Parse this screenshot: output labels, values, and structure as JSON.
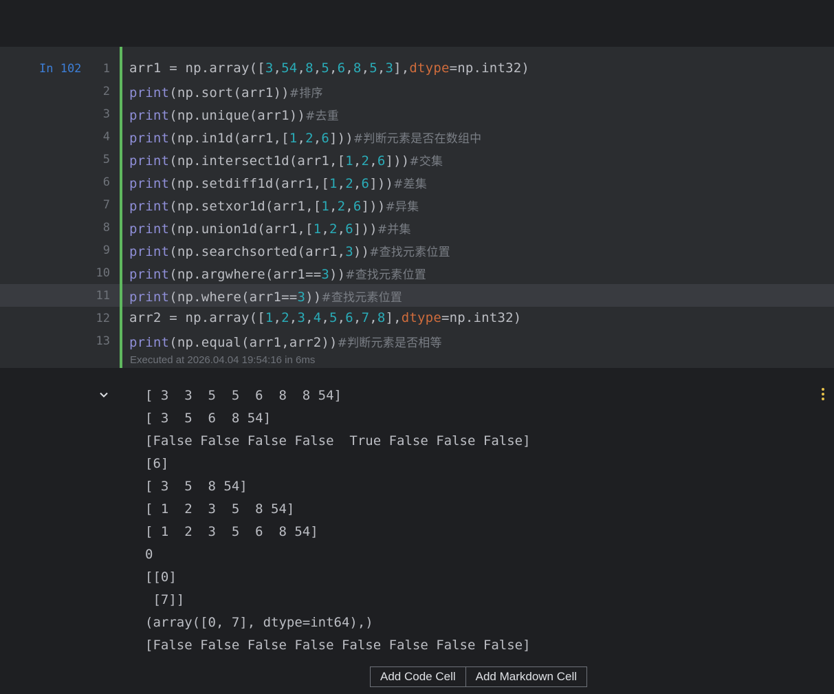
{
  "cell": {
    "prompt": "In 102",
    "line_numbers": [
      "1",
      "2",
      "3",
      "4",
      "5",
      "6",
      "7",
      "8",
      "9",
      "10",
      "11",
      "12",
      "13"
    ],
    "executed": "Executed at 2026.04.04 19:54:16 in 6ms",
    "comments": {
      "c2": "#排序",
      "c3": "#去重",
      "c4": "#判断元素是否在数组中",
      "c5": "#交集",
      "c6": "#差集",
      "c7": "#异集",
      "c8": "#并集",
      "c9": "#查找元素位置",
      "c10": "#查找元素位置",
      "c11": "#查找元素位置",
      "c13": "#判断元素是否相等"
    }
  },
  "output": {
    "lines": [
      "[ 3  3  5  5  6  8  8 54]",
      "[ 3  5  6  8 54]",
      "[False False False False  True False False False]",
      "[6]",
      "[ 3  5  8 54]",
      "[ 1  2  3  5  8 54]",
      "[ 1  2  3  5  6  8 54]",
      "0",
      "[[0]",
      " [7]]",
      "(array([0, 7], dtype=int64),)",
      "[False False False False False False False False]"
    ]
  },
  "buttons": {
    "add_code": "Add Code Cell",
    "add_markdown": "Add Markdown Cell"
  },
  "icons": {
    "collapse": "chevron-down-icon",
    "menu": "more-vertical-icon"
  },
  "colors": {
    "cell_bar": "#5fb85f",
    "prompt": "#3d7fd8"
  }
}
